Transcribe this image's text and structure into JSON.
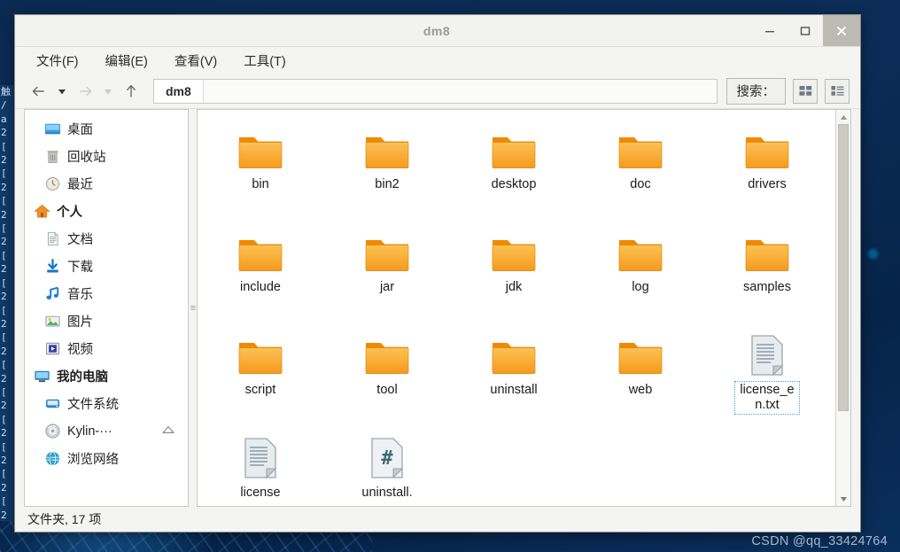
{
  "window": {
    "title": "dm8",
    "controls": {
      "minimize": "–",
      "maximize": "☐",
      "close": "✕"
    }
  },
  "menubar": {
    "items": [
      {
        "label": "文件(F)",
        "name": "menu-file"
      },
      {
        "label": "编辑(E)",
        "name": "menu-edit"
      },
      {
        "label": "查看(V)",
        "name": "menu-view"
      },
      {
        "label": "工具(T)",
        "name": "menu-tools"
      }
    ]
  },
  "toolbar": {
    "back": "←",
    "back_dropdown": "▼",
    "forward": "→",
    "forward_dropdown": "▼",
    "up": "↑",
    "path_crumb": "dm8",
    "search_label": "搜索：",
    "view_icon_label": "icon-view",
    "view_list_label": "list-view"
  },
  "sidebar": {
    "items": [
      {
        "label": "桌面",
        "icon": "desktop-icon",
        "name": "sidebar-item-desktop",
        "root": false,
        "eject": false
      },
      {
        "label": "回收站",
        "icon": "trash-icon",
        "name": "sidebar-item-trash",
        "root": false,
        "eject": false
      },
      {
        "label": "最近",
        "icon": "clock-icon",
        "name": "sidebar-item-recent",
        "root": false,
        "eject": false
      },
      {
        "label": "个人",
        "icon": "home-icon",
        "name": "sidebar-item-home",
        "root": true,
        "eject": false
      },
      {
        "label": "文档",
        "icon": "document-icon",
        "name": "sidebar-item-documents",
        "root": false,
        "eject": false
      },
      {
        "label": "下载",
        "icon": "download-icon",
        "name": "sidebar-item-downloads",
        "root": false,
        "eject": false
      },
      {
        "label": "音乐",
        "icon": "music-icon",
        "name": "sidebar-item-music",
        "root": false,
        "eject": false
      },
      {
        "label": "图片",
        "icon": "picture-icon",
        "name": "sidebar-item-pictures",
        "root": false,
        "eject": false
      },
      {
        "label": "视频",
        "icon": "video-icon",
        "name": "sidebar-item-videos",
        "root": false,
        "eject": false
      },
      {
        "label": "我的电脑",
        "icon": "computer-icon",
        "name": "sidebar-item-computer",
        "root": true,
        "eject": false
      },
      {
        "label": "文件系统",
        "icon": "filesystem-icon",
        "name": "sidebar-item-filesystem",
        "root": false,
        "eject": false
      },
      {
        "label": "Kylin-···",
        "icon": "disc-icon",
        "name": "sidebar-item-kylin-disc",
        "root": false,
        "eject": true
      },
      {
        "label": "浏览网络",
        "icon": "network-icon",
        "name": "sidebar-item-network",
        "root": false,
        "eject": false
      }
    ]
  },
  "files": [
    {
      "name": "bin",
      "type": "folder",
      "focused": false
    },
    {
      "name": "bin2",
      "type": "folder",
      "focused": false
    },
    {
      "name": "desktop",
      "type": "folder",
      "focused": false
    },
    {
      "name": "doc",
      "type": "folder",
      "focused": false
    },
    {
      "name": "drivers",
      "type": "folder",
      "focused": false
    },
    {
      "name": "include",
      "type": "folder",
      "focused": false
    },
    {
      "name": "jar",
      "type": "folder",
      "focused": false
    },
    {
      "name": "jdk",
      "type": "folder",
      "focused": false
    },
    {
      "name": "log",
      "type": "folder",
      "focused": false
    },
    {
      "name": "samples",
      "type": "folder",
      "focused": false
    },
    {
      "name": "script",
      "type": "folder",
      "focused": false
    },
    {
      "name": "tool",
      "type": "folder",
      "focused": false
    },
    {
      "name": "uninstall",
      "type": "folder",
      "focused": false
    },
    {
      "name": "web",
      "type": "folder",
      "focused": false
    },
    {
      "name": "license_en.txt",
      "type": "text",
      "focused": true
    },
    {
      "name": "license",
      "type": "text",
      "focused": false
    },
    {
      "name": "uninstall.",
      "type": "script",
      "focused": false
    }
  ],
  "statusbar": {
    "text": "文件夹, 17 项"
  },
  "background_terminal": {
    "lines": [
      "触",
      "/",
      "a",
      "2",
      "[",
      "2",
      "[",
      "2",
      "[",
      "2",
      "[",
      "2",
      "[",
      "2",
      "[",
      "2",
      "[",
      "2",
      "[",
      "2",
      "[",
      "2",
      "[",
      "2",
      "[",
      "2",
      "[",
      "2",
      "[",
      "2",
      "[",
      "2",
      "[",
      "2"
    ]
  },
  "watermark": {
    "text": "CSDN @qq_33424764"
  },
  "colors": {
    "desktop": "#0a2a52",
    "window_bg": "#f4f4f2",
    "titlebar": "#f2f2f0",
    "close_btn": "#bdbab3",
    "folder": "#f5a623",
    "folder_tab": "#f08a00",
    "text_file": "#dfe5e8",
    "focus_outline": "#4f9fd8",
    "accent_blue": "#1c6fb8"
  }
}
